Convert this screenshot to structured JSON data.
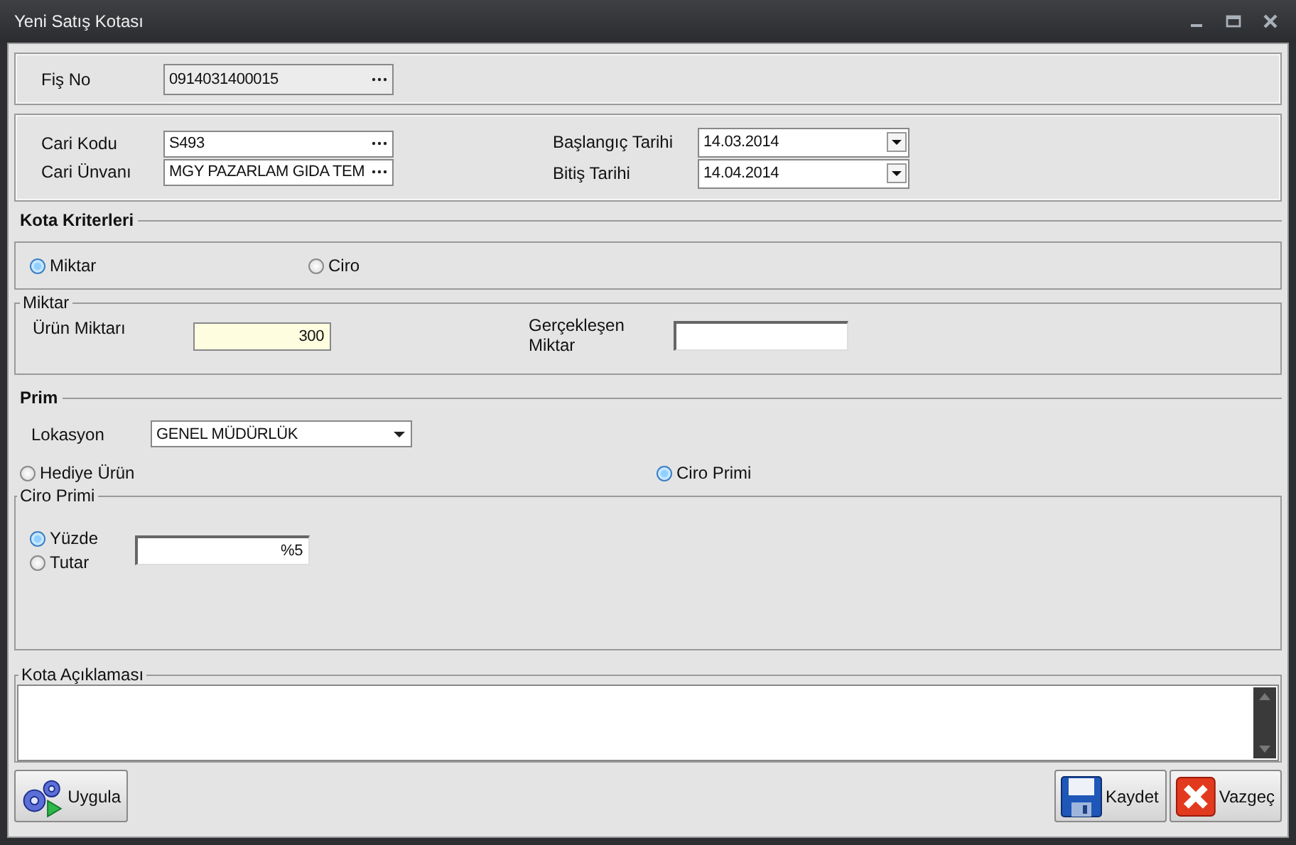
{
  "window": {
    "title": "Yeni Satış Kotası"
  },
  "fis_no": {
    "label": "Fiş No",
    "value": "0914031400015"
  },
  "cari": {
    "kodu_label": "Cari Kodu",
    "kodu": "S493",
    "unvan_label": "Cari Ünvanı",
    "unvan": "MGY PAZARLAM GIDA TEM",
    "baslangic_label": "Başlangıç Tarihi",
    "baslangic": "14.03.2014",
    "bitis_label": "Bitiş Tarihi",
    "bitis": "14.04.2014"
  },
  "kota_kriterleri": {
    "title": "Kota Kriterleri",
    "options": [
      {
        "label": "Miktar",
        "selected": true
      },
      {
        "label": "Ciro",
        "selected": false
      }
    ]
  },
  "miktar": {
    "title": "Miktar",
    "urun_label": "Ürün Miktarı",
    "urun": "300",
    "gerceklesen_label": "Gerçekleşen Miktar"
  },
  "prim": {
    "title": "Prim",
    "lokasyon_label": "Lokasyon",
    "lokasyon": "GENEL MÜDÜRLÜK",
    "options": [
      {
        "label": "Hediye Ürün",
        "selected": false
      },
      {
        "label": "Ciro Primi",
        "selected": true
      }
    ]
  },
  "ciro_primi": {
    "title": "Ciro Primi",
    "options": [
      {
        "label": "Yüzde",
        "selected": true
      },
      {
        "label": "Tutar",
        "selected": false
      }
    ],
    "value": "%5"
  },
  "aciklama": {
    "title": "Kota Açıklaması"
  },
  "buttons": [
    {
      "kind": "apply",
      "label": "Uygula"
    },
    {
      "kind": "save",
      "label": "Kaydet"
    },
    {
      "kind": "cancel",
      "label": "Vazgeç"
    }
  ]
}
